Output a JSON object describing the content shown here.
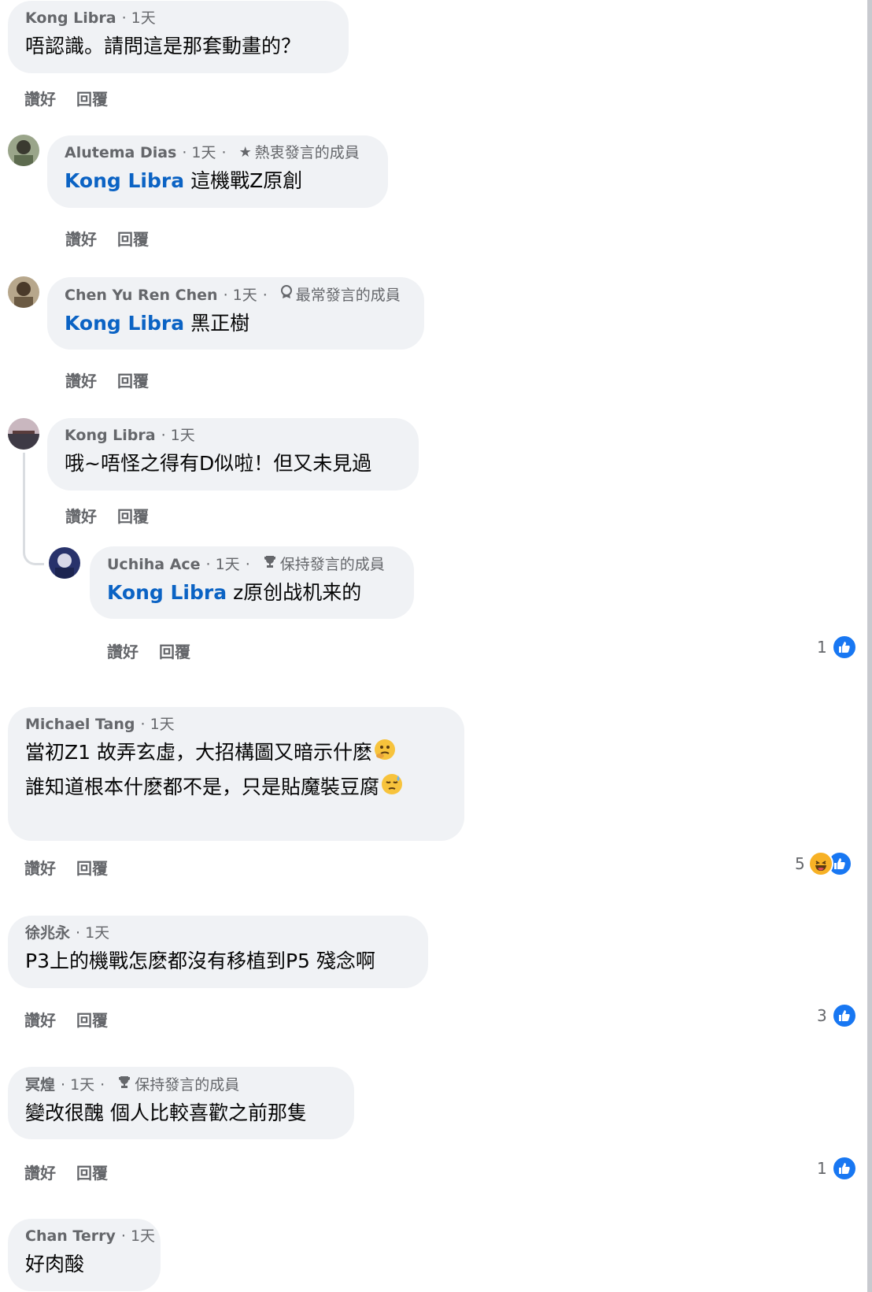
{
  "actions": {
    "like": "讚好",
    "reply": "回覆"
  },
  "comments": [
    {
      "author": "Kong Libra",
      "time": "1天",
      "text": "唔認識。請問這是那套動畫的？"
    },
    {
      "author": "Alutema Dias",
      "time": "1天",
      "badge": "熱衷發言的成員",
      "badge_icon": "star-icon",
      "tag": "Kong Libra",
      "text": "這機戰Z原創"
    },
    {
      "author": "Chen Yu Ren Chen",
      "time": "1天",
      "badge": "最常發言的成員",
      "badge_icon": "medal-icon",
      "tag": "Kong Libra",
      "text": "黑正樹"
    },
    {
      "author": "Kong Libra",
      "time": "1天",
      "text": "哦~唔怪之得有D似啦！但又未見過"
    },
    {
      "author": "Uchiha Ace",
      "time": "1天",
      "badge": "保持發言的成員",
      "badge_icon": "trophy-icon",
      "tag": "Kong Libra",
      "text": "z原创战机来的",
      "reactions": "1"
    },
    {
      "author": "Michael Tang",
      "time": "1天",
      "text": "當初Z1 故弄玄虛，大招構圖又暗示什麽",
      "text2": "誰知道根本什麽都不是，只是貼魔裝豆腐",
      "reactions": "5"
    },
    {
      "author": "徐兆永",
      "time": "1天",
      "text": "P3上的機戰怎麽都沒有移植到P5 殘念啊",
      "reactions": "3"
    },
    {
      "author": "冥煌",
      "time": "1天",
      "badge": "保持發言的成員",
      "badge_icon": "trophy-icon",
      "text": "變改很醜 個人比較喜歡之前那隻",
      "reactions": "1"
    },
    {
      "author": "Chan Terry",
      "time": "1天",
      "text": "好肉酸"
    }
  ],
  "colors": {
    "bubble": "#f0f2f5",
    "mention": "#0b63c4",
    "like_blue": "#1877f2",
    "meta": "#65676b"
  }
}
